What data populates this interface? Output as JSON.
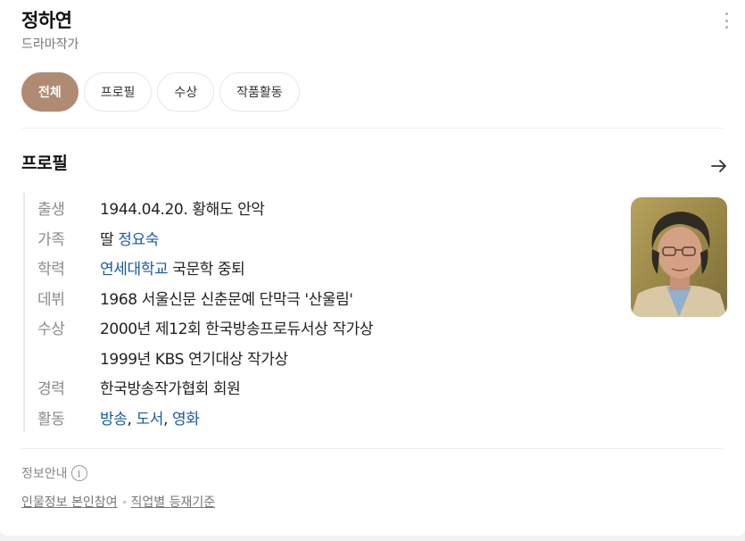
{
  "header": {
    "name": "정하연",
    "subtitle": "드라마작가",
    "more_icon": "more-vertical-icon"
  },
  "tabs": [
    {
      "label": "전체",
      "active": true
    },
    {
      "label": "프로필",
      "active": false
    },
    {
      "label": "수상",
      "active": false
    },
    {
      "label": "작품활동",
      "active": false
    }
  ],
  "profile": {
    "title": "프로필",
    "arrow_icon": "arrow-right-icon",
    "rows": {
      "birth": {
        "label": "출생",
        "value": "1944.04.20. 황해도 안악"
      },
      "family": {
        "label": "가족",
        "prefix": "딸 ",
        "link": "정요숙"
      },
      "education": {
        "label": "학력",
        "link": "연세대학교",
        "suffix": " 국문학 중퇴"
      },
      "debut": {
        "label": "데뷔",
        "value": "1968 서울신문 신춘문예 단막극 '산울림'"
      },
      "awards": {
        "label": "수상",
        "value1": "2000년 제12회 한국방송프로듀서상 작가상",
        "value2": "1999년 KBS 연기대상 작가상"
      },
      "career": {
        "label": "경력",
        "value": "한국방송작가협회 회원"
      },
      "activity": {
        "label": "활동",
        "links": [
          "방송",
          "도서",
          "영화"
        ],
        "sep": ", "
      }
    }
  },
  "footer": {
    "info_label": "정보안내",
    "info_icon": "info-icon",
    "info_glyph": "i",
    "links": [
      "인물정보 본인참여",
      "직업별 등재기준"
    ]
  },
  "colors": {
    "active_tab": "#b08b74",
    "link": "#1a5aa6"
  }
}
